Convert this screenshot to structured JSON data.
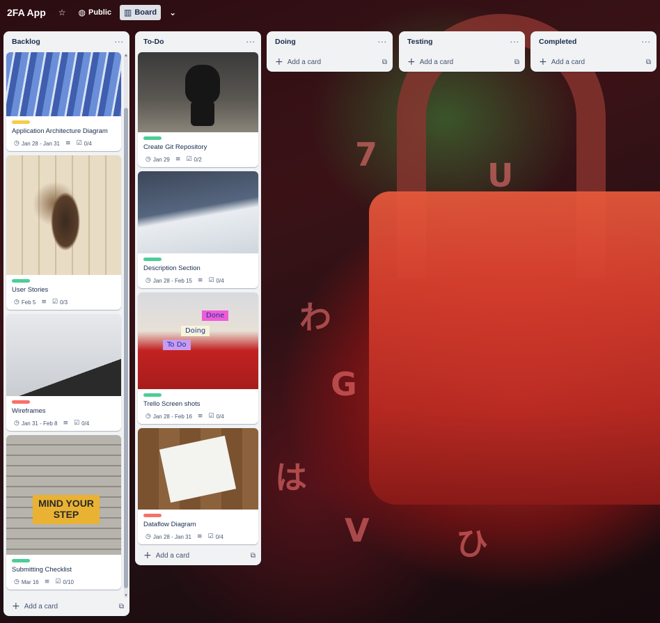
{
  "board": {
    "title": "2FA App",
    "visibility_label": "Public",
    "view_label": "Board"
  },
  "lists": [
    {
      "title": "Backlog",
      "add_card_label": "Add a card",
      "cards": [
        {
          "title": "Application Architecture Diagram",
          "label_color": "#f5cd47",
          "dates": "Jan 28 - Jan 31",
          "checklist": "0/4",
          "has_description": true
        },
        {
          "title": "User Stories",
          "label_color": "#4bce97",
          "dates": "Feb 5",
          "checklist": "0/3",
          "has_description": true
        },
        {
          "title": "Wireframes",
          "label_color": "#f87168",
          "dates": "Jan 31 - Feb 8",
          "checklist": "0/4",
          "has_description": true
        },
        {
          "title": "Submitting Checklist",
          "label_color": "#4bce97",
          "dates": "Mar 16",
          "checklist": "0/10",
          "has_description": true
        }
      ],
      "cover_text": "MIND YOUR STEP"
    },
    {
      "title": "To-Do",
      "add_card_label": "Add a card",
      "cards": [
        {
          "title": "Create Git Repository",
          "label_color": "#4bce97",
          "dates": "Jan 29",
          "checklist": "0/2",
          "has_description": true
        },
        {
          "title": "Description Section",
          "label_color": "#4bce97",
          "dates": "Jan 28 - Feb 15",
          "checklist": "0/4",
          "has_description": true
        },
        {
          "title": "Trello Screen shots",
          "label_color": "#4bce97",
          "dates": "Jan 28 - Feb 16",
          "checklist": "0/4",
          "has_description": true
        },
        {
          "title": "Dataflow Diagram",
          "label_color": "#f87168",
          "dates": "Jan 28 - Jan 31",
          "checklist": "0/4",
          "has_description": true
        }
      ],
      "sticky_notes": [
        "Done",
        "Doing",
        "To Do"
      ]
    },
    {
      "title": "Doing",
      "add_card_label": "Add a card"
    },
    {
      "title": "Testing",
      "add_card_label": "Add a card"
    },
    {
      "title": "Completed",
      "add_card_label": "Add a card"
    }
  ],
  "icons": {
    "star": "star-icon",
    "globe": "globe-icon",
    "board": "board-icon",
    "chevron": "chevron-down-icon",
    "menu": "ellipsis-icon",
    "plus": "plus-icon",
    "template": "template-icon",
    "clock": "clock-icon",
    "description": "description-icon",
    "checklist": "checklist-icon"
  },
  "background_keys": [
    "7",
    "U",
    "G",
    "V",
    "わ",
    "は",
    "ひ"
  ]
}
